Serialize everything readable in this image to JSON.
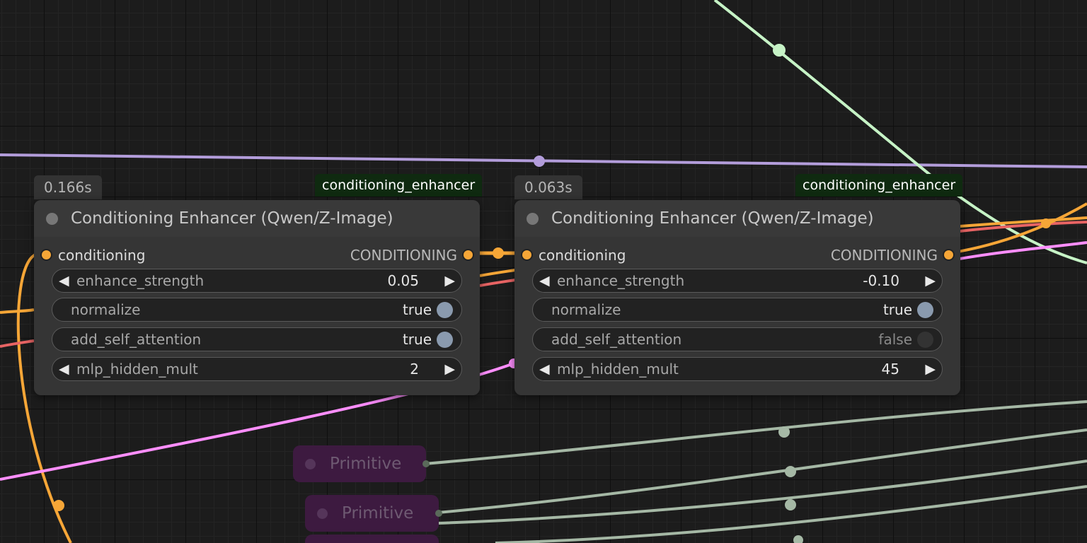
{
  "colors": {
    "canvas_bg": "#1c1c1c",
    "node_bg": "#353535",
    "conditioning_link": "#f6a637",
    "clip_link": "#b39ddb",
    "latent_link": "#ff8eff",
    "float_link": "#c6f3c6",
    "int_link": "#a5b8a5",
    "red_link": "#e86464",
    "type_badge_bg": "#0f2a10",
    "primitive_bg": "#3d1a40"
  },
  "nodes": [
    {
      "exec_time": "0.166s",
      "type": "conditioning_enhancer",
      "title": "Conditioning Enhancer (Qwen/Z-Image)",
      "input_label": "conditioning",
      "output_label": "CONDITIONING",
      "widgets": {
        "enhance_strength": {
          "label": "enhance_strength",
          "value": "0.05"
        },
        "normalize": {
          "label": "normalize",
          "value": "true"
        },
        "add_self_attention": {
          "label": "add_self_attention",
          "value": "true"
        },
        "mlp_hidden_mult": {
          "label": "mlp_hidden_mult",
          "value": "2"
        }
      }
    },
    {
      "exec_time": "0.063s",
      "type": "conditioning_enhancer",
      "title": "Conditioning Enhancer (Qwen/Z-Image)",
      "input_label": "conditioning",
      "output_label": "CONDITIONING",
      "widgets": {
        "enhance_strength": {
          "label": "enhance_strength",
          "value": "-0.10"
        },
        "normalize": {
          "label": "normalize",
          "value": "true"
        },
        "add_self_attention": {
          "label": "add_self_attention",
          "value": "false"
        },
        "mlp_hidden_mult": {
          "label": "mlp_hidden_mult",
          "value": "45"
        }
      }
    }
  ],
  "primitives": [
    {
      "title": "Primitive"
    },
    {
      "title": "Primitive"
    }
  ],
  "icons": {
    "decrement": "◀",
    "increment": "▶"
  }
}
